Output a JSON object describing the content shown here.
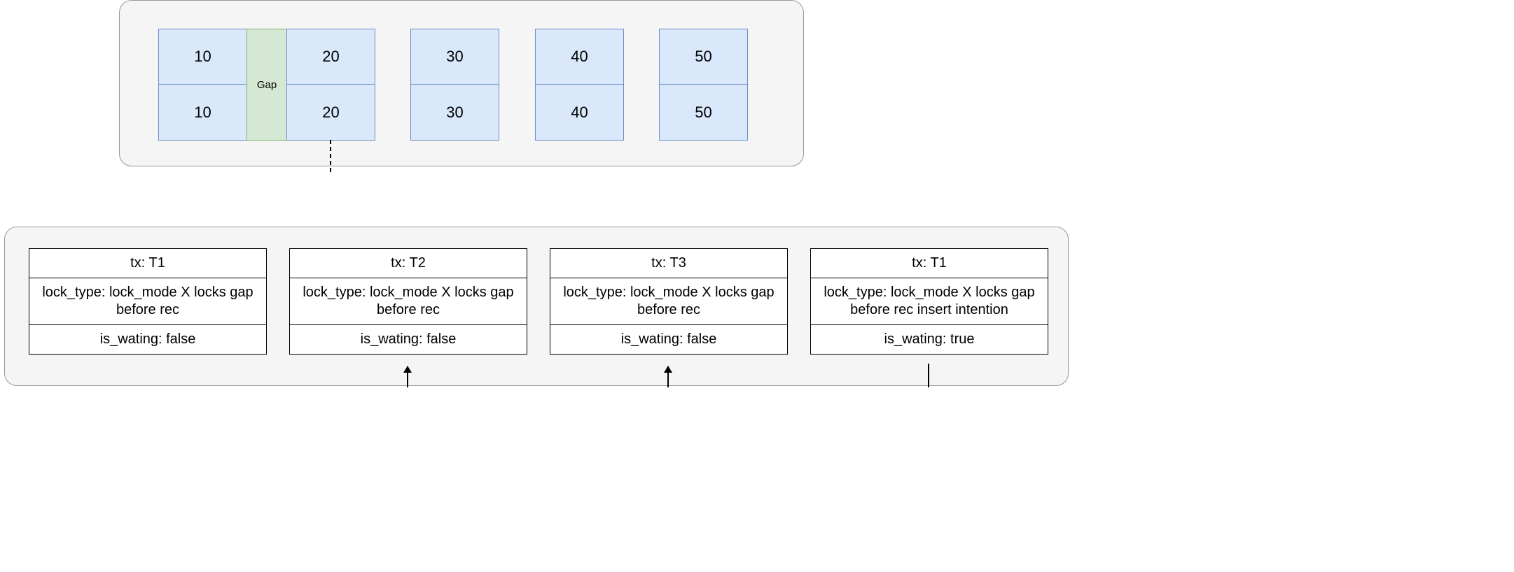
{
  "records": {
    "gap_label": "Gap",
    "columns": [
      {
        "top": "10",
        "bottom": "10"
      },
      {
        "top": "20",
        "bottom": "20"
      },
      {
        "top": "30",
        "bottom": "30"
      },
      {
        "top": "40",
        "bottom": "40"
      },
      {
        "top": "50",
        "bottom": "50"
      }
    ]
  },
  "locks": [
    {
      "tx": "tx: T1",
      "lock_type": "lock_type: lock_mode X locks gap before rec",
      "is_waiting": "is_wating: false"
    },
    {
      "tx": "tx: T2",
      "lock_type": "lock_type:  lock_mode X locks gap before rec",
      "is_waiting": "is_wating: false"
    },
    {
      "tx": "tx: T3",
      "lock_type": "lock_type: lock_mode X locks gap before rec",
      "is_waiting": "is_wating: false"
    },
    {
      "tx": "tx: T1",
      "lock_type": "lock_type: lock_mode X locks gap before rec insert intention",
      "is_waiting": "is_wating: true"
    }
  ]
}
